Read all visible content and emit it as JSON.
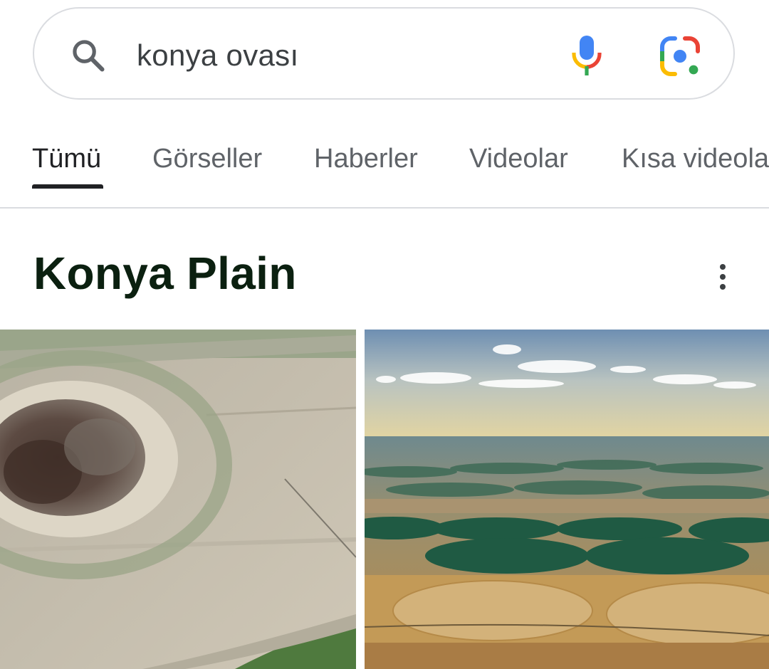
{
  "search": {
    "query": "konya ovası"
  },
  "tabs": [
    {
      "label": "Tümü",
      "active": true
    },
    {
      "label": "Görseller",
      "active": false
    },
    {
      "label": "Haberler",
      "active": false
    },
    {
      "label": "Videolar",
      "active": false
    },
    {
      "label": "Kısa videolar",
      "active": false
    }
  ],
  "knowledge_panel": {
    "title": "Konya Plain"
  },
  "icons": {
    "search": "search-icon",
    "mic": "mic-icon",
    "lens": "lens-icon",
    "more": "more-vert-icon"
  },
  "images": [
    {
      "subject": "sinkhole in field"
    },
    {
      "subject": "circular irrigated fields"
    }
  ],
  "colors": {
    "google_blue": "#4285f4",
    "google_red": "#ea4335",
    "google_yellow": "#fbbc04",
    "google_green": "#34a853",
    "title_color": "#0b2010"
  }
}
